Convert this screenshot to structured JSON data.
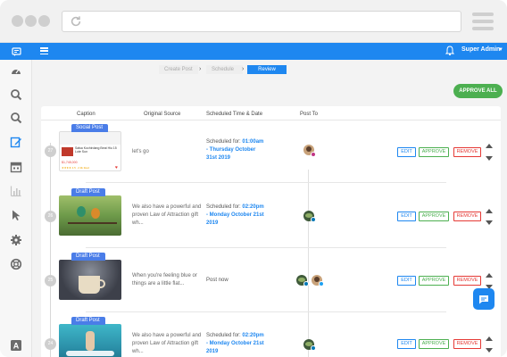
{
  "topbar": {
    "user_name": "Super Admin"
  },
  "steps": [
    "Create Post",
    "Schedule",
    "Review"
  ],
  "approve_all_label": "APPROVE ALL",
  "columns": {
    "caption": "Caption",
    "source": "Original Source",
    "time": "Scheduled Time & Date",
    "post_to": "Post To"
  },
  "actions": {
    "edit": "EDIT",
    "approve": "APPROVE",
    "remove": "REMOVE"
  },
  "rows": [
    {
      "number": "27",
      "badge": "Social Post",
      "source": "let's go",
      "sched_prefix": "Scheduled for:",
      "sched_time": "01:00am",
      "sched_date": "- Thursday October 31st 2019",
      "sched_plain": ""
    },
    {
      "number": "26",
      "badge": "Draft Post",
      "source": "We also have a powerful and proven Law of Attraction gift wh...",
      "sched_prefix": "Scheduled for:",
      "sched_time": "02:20pm",
      "sched_date": "- Monday October 21st 2019",
      "sched_plain": ""
    },
    {
      "number": "25",
      "badge": "Draft Post",
      "source": "When you're feeling blue or things are a little flat...",
      "sched_prefix": "",
      "sched_time": "",
      "sched_date": "",
      "sched_plain": "Post now"
    },
    {
      "number": "24",
      "badge": "Draft Post",
      "source": "We also have a powerful and proven Law of Attraction gift wh...",
      "sched_prefix": "Scheduled for:",
      "sched_time": "02:20pm",
      "sched_date": "- Monday October 21st 2019",
      "sched_plain": ""
    }
  ],
  "thumb1": {
    "title": "Salsa Kochirdang Beat Hiu 15 Lote Sun",
    "price": "$1,745,000",
    "detail": "★★★★ 4.5 . 2.9k liked"
  },
  "icons": {
    "sidebar": [
      "dashboard-icon",
      "search-icon",
      "search-icon-2",
      "edit-icon",
      "calendar-icon",
      "chart-icon",
      "cursor-icon",
      "settings-icon",
      "support-icon",
      "font-icon"
    ],
    "networks": [
      "instagram",
      "linkedin",
      "twitter",
      "linkedin"
    ]
  },
  "colors": {
    "primary": "#1e87f0",
    "approve": "#4caf50",
    "remove": "#e53935",
    "badge": "#4a7de8"
  }
}
